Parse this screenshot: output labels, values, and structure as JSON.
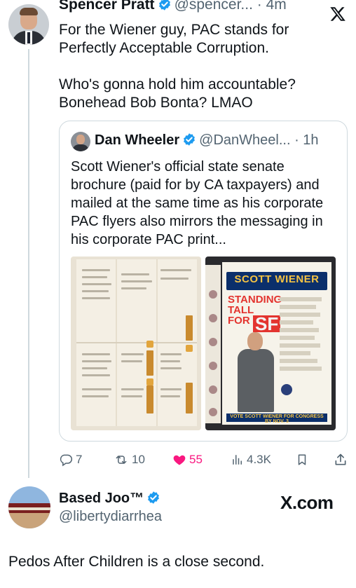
{
  "colors": {
    "accent": "#1d9bf0",
    "like": "#f91880",
    "muted": "#536471"
  },
  "tweet1": {
    "name": "Spencer Pratt",
    "handle": "@spencer...",
    "time": "· 4m",
    "lines": [
      "For the Wiener guy, PAC stands for Perfectly Acceptable Corruption.",
      "Who's gonna hold him accountable? Bonehead Bob Bonta? LMAO"
    ]
  },
  "quote": {
    "name": "Dan Wheeler",
    "handle": "@DanWheel...",
    "time": "· 1h",
    "text": "Scott Wiener's official state senate brochure (paid for by CA taxpayers) and mailed at the same time as his corporate PAC flyers also mirrors the messaging in his corporate PAC print...",
    "flyer": {
      "banner": "SCOTT WIENER",
      "slogan": "STANDING TALL FOR",
      "sf": "SF",
      "footer": "VOTE SCOTT WIENER FOR CONGRESS BY NOV. 3"
    }
  },
  "actions": {
    "replies": "7",
    "retweets": "10",
    "likes": "55",
    "views": "4.3K"
  },
  "tweet2": {
    "name": "Based Joo™",
    "handle": "@libertydiarrhea",
    "watermark": "X.com",
    "text": "Pedos After Children is a close second."
  }
}
